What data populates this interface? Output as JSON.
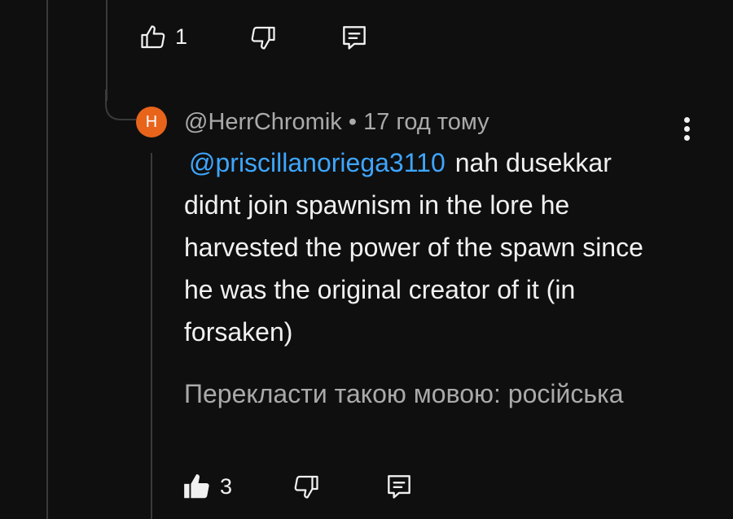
{
  "parent_actions": {
    "like_icon": "thumb-up-outline",
    "like_count": "1",
    "dislike_icon": "thumb-down-outline",
    "reply_icon": "comment-outline"
  },
  "reply": {
    "avatar_letter": "H",
    "avatar_color": "#e8641b",
    "author": "@HerrChromik",
    "separator": "•",
    "time": "17 год тому",
    "mention": "@priscillanoriega3110",
    "text": "nah dusekkar didnt join spawnism in the lore he harvested the power of the spawn since he was the original creator of it (in forsaken)",
    "translate_label": "Перекласти такою мовою: російська",
    "menu_icon": "more-vertical",
    "like_icon": "thumb-up-filled",
    "like_count": "3",
    "dislike_icon": "thumb-down-outline",
    "reply_icon": "comment-outline"
  },
  "colors": {
    "background": "#0f0f0f",
    "text": "#f1f1f1",
    "secondary_text": "#aaaaaa",
    "mention": "#3ea6ff",
    "thread_line": "#3a3a3a"
  }
}
